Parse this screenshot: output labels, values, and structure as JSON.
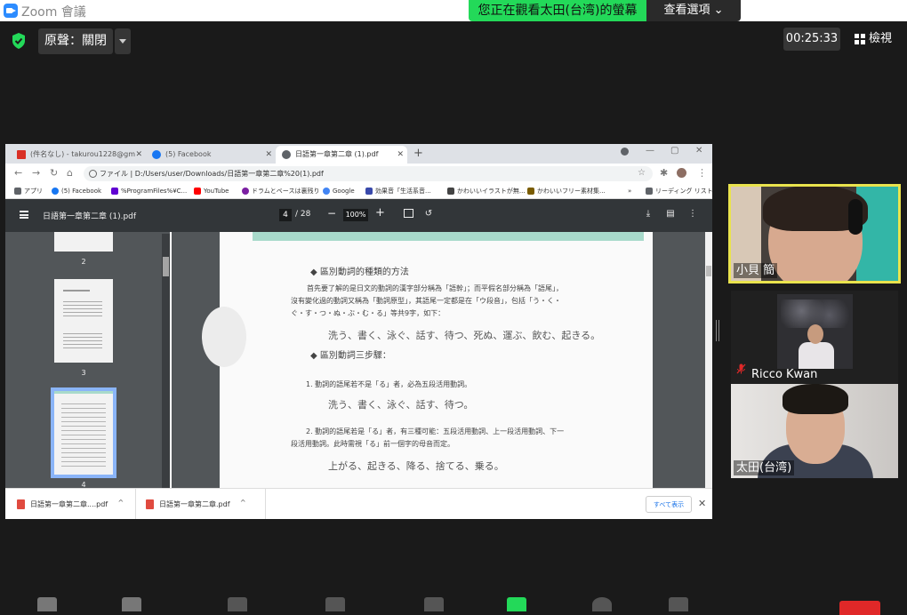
{
  "window": {
    "title": "Zoom 會議"
  },
  "banner": {
    "viewing": "您正在觀看太田(台湾)的螢幕",
    "options": "查看選項 ⌄"
  },
  "controls": {
    "audio": "原聲：關閉",
    "timer": "00:25:33",
    "view": "檢視"
  },
  "browser": {
    "tabs": [
      {
        "label": "(件名なし) - takurou1228@gm",
        "icon_color": "#d93025"
      },
      {
        "label": "(5) Facebook",
        "icon_color": "#1877f2"
      },
      {
        "label": "日語第一章第二章 (1).pdf",
        "icon_color": "#5f6368"
      }
    ],
    "address": "ファイル  |  D:/Users/user/Downloads/日語第一章第二章%20(1).pdf",
    "bookmarks": [
      {
        "label": "アプリ",
        "color": "#5f6368"
      },
      {
        "label": "(5) Facebook",
        "color": "#1877f2"
      },
      {
        "label": "%ProgramFiles%¥C...",
        "color": "#6001d2"
      },
      {
        "label": "YouTube",
        "color": "#ff0000"
      },
      {
        "label": "ドラムとベースは裏残り",
        "color": "#7b1fa2"
      },
      {
        "label": "Google",
        "color": "#4285f4"
      },
      {
        "label": "効果音「生活系音...",
        "color": "#3949ab"
      },
      {
        "label": "かわいいイラストが無...",
        "color": "#444444"
      },
      {
        "label": "かわいいフリー素材集...",
        "color": "#7a5c00"
      }
    ],
    "reading_list": "リーディング リスト",
    "more": "»"
  },
  "pdf": {
    "filename": "日語第一章第二章 (1).pdf",
    "page": "4",
    "total": "/ 28",
    "zoom": "100%",
    "thumb_numbers": [
      "2",
      "3",
      "4"
    ],
    "lines": [
      "◆ 區別動詞的種類的方法",
      "首先要了解的是日文的動詞的漢字部分稱為「語幹」；而平假名部分稱為「語尾」，",
      "沒有變化過的動詞又稱為「動詞原型」，其語尾一定都是在「ウ段音」，包括「う・く・",
      "ぐ・す・つ・ぬ・ぶ・む・る」等共9字，如下：",
      "洗う、書く、泳ぐ、話す、待つ、死ぬ、運ぶ、飲む、起きる。",
      "◆ 區別動詞三步驟：",
      "1. 動詞的語尾若不是「る」者，必為五段活用動詞。",
      "洗う、書く、泳ぐ、話す、待つ。",
      "2. 動詞的語尾若是「る」者，有三種可能：五段活用動詞、上一段活用動詞、下一",
      "段活用動詞。此時需視「る」前一個字的母音而定。",
      "上がる、起きる、降る、捨てる、乗る。"
    ]
  },
  "downloads": {
    "items": [
      "日語第一章第二章....pdf",
      "日語第一章第二章.pdf"
    ],
    "show_all": "すべて表示"
  },
  "participants": [
    {
      "name": "小貝 簡"
    },
    {
      "name": "Ricco Kwan"
    },
    {
      "name": "太田(台湾)"
    }
  ]
}
